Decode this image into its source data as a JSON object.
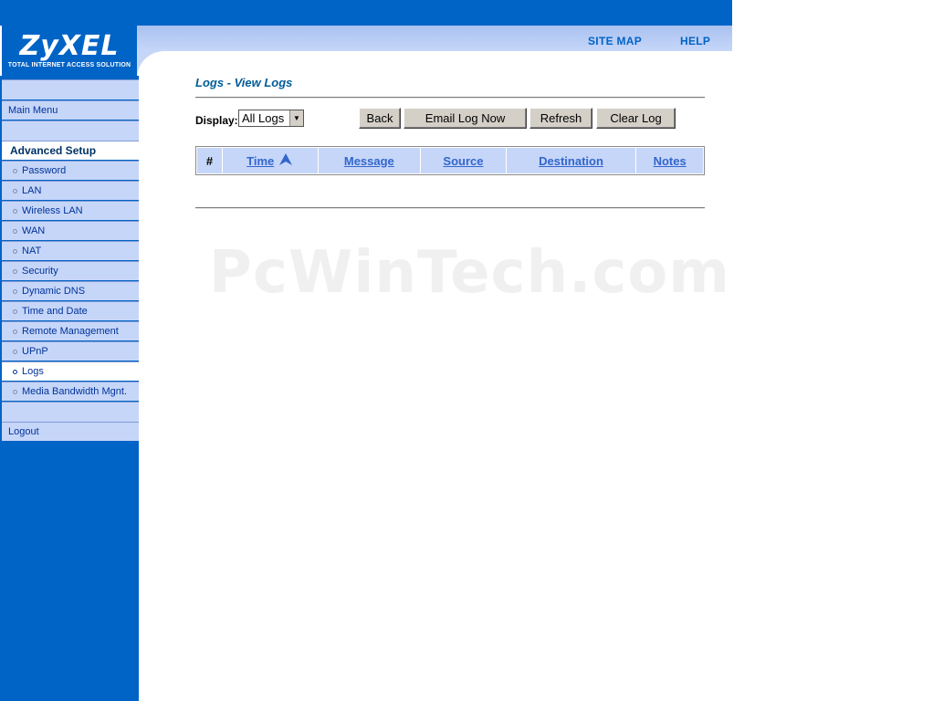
{
  "header": {
    "logo_text": "ZyXEL",
    "logo_tagline": "TOTAL INTERNET ACCESS SOLUTION",
    "site_map": "SITE MAP",
    "help": "HELP"
  },
  "sidebar": {
    "main_menu": "Main Menu",
    "section_heading": "Advanced Setup",
    "items": [
      {
        "label": "Password"
      },
      {
        "label": "LAN"
      },
      {
        "label": "Wireless LAN"
      },
      {
        "label": "WAN"
      },
      {
        "label": "NAT"
      },
      {
        "label": "Security"
      },
      {
        "label": "Dynamic DNS"
      },
      {
        "label": "Time and Date"
      },
      {
        "label": "Remote Management"
      },
      {
        "label": "UPnP"
      },
      {
        "label": "Logs"
      },
      {
        "label": "Media Bandwidth Mgnt."
      }
    ],
    "active_item": "Logs",
    "logout": "Logout"
  },
  "main": {
    "title": "Logs - View Logs",
    "display_label": "Display:",
    "display_value": "All Logs",
    "buttons": {
      "back": "Back",
      "email": "Email Log Now",
      "refresh": "Refresh",
      "clear": "Clear Log"
    },
    "table": {
      "columns": [
        "#",
        "Time",
        "Message",
        "Source",
        "Destination",
        "Notes"
      ],
      "sorted_by": "Time",
      "rows": []
    }
  },
  "watermark": "PcWinTech.com",
  "colors": {
    "brand_blue": "#0063c6",
    "nav_light": "#c6d6f9",
    "link_blue": "#3366cc"
  }
}
